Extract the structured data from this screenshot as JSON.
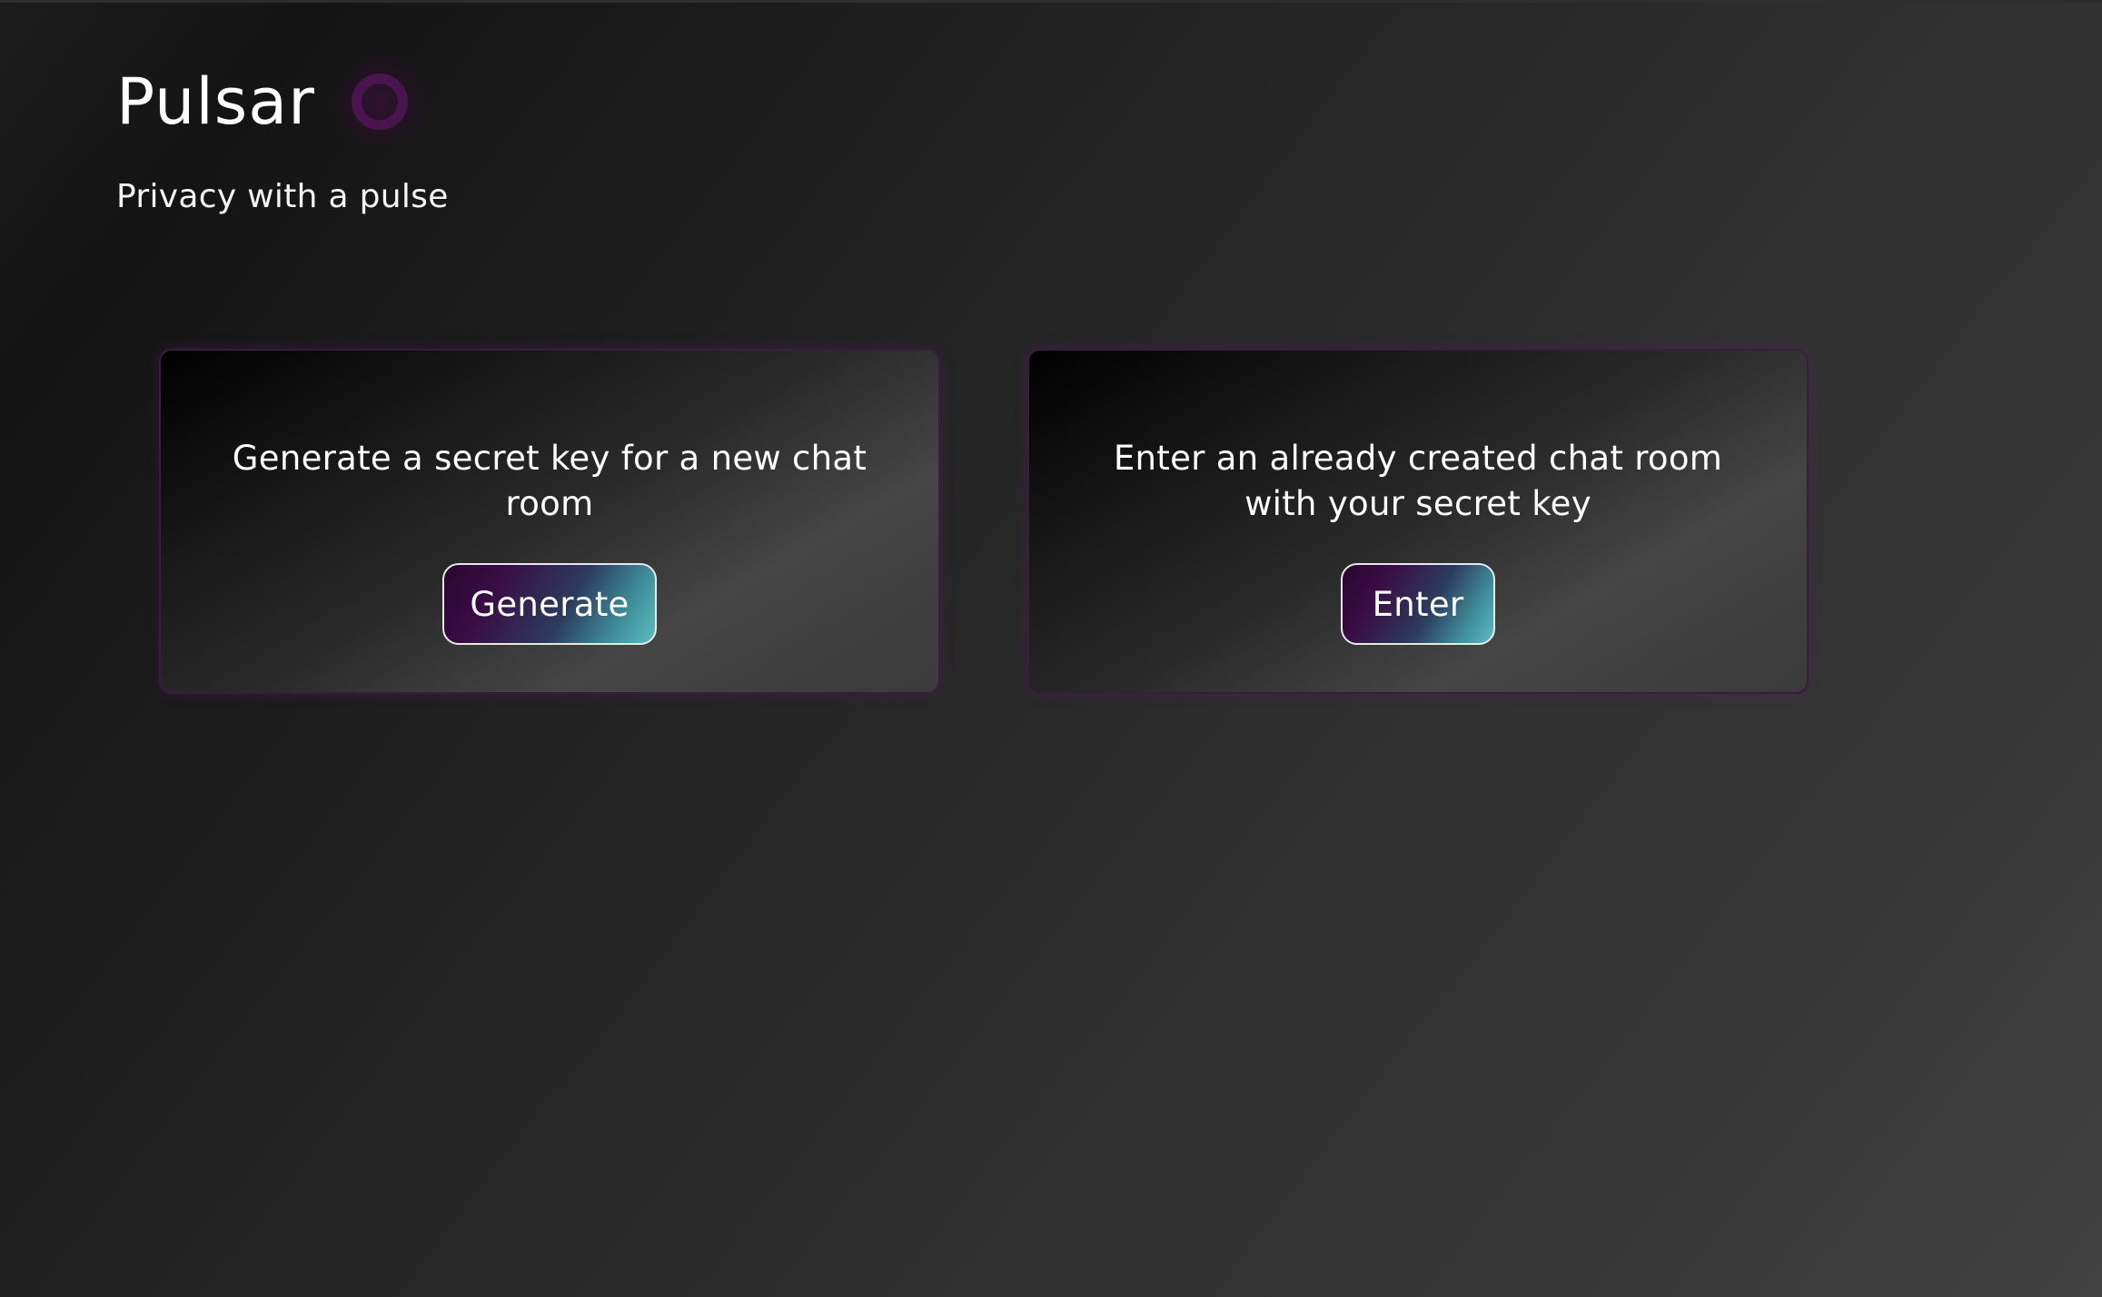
{
  "app": {
    "title": "Pulsar",
    "tagline": "Privacy with a pulse",
    "logo_icon": "pulse-ring-icon",
    "colors": {
      "accent_purple": "#4a1450",
      "accent_teal": "#5dbdc0",
      "text": "#ffffff"
    }
  },
  "cards": {
    "generate": {
      "description": "Generate a secret key for a new chat room",
      "button_label": "Generate"
    },
    "enter": {
      "description": "Enter an already created chat room with your secret key",
      "button_label": "Enter"
    }
  }
}
